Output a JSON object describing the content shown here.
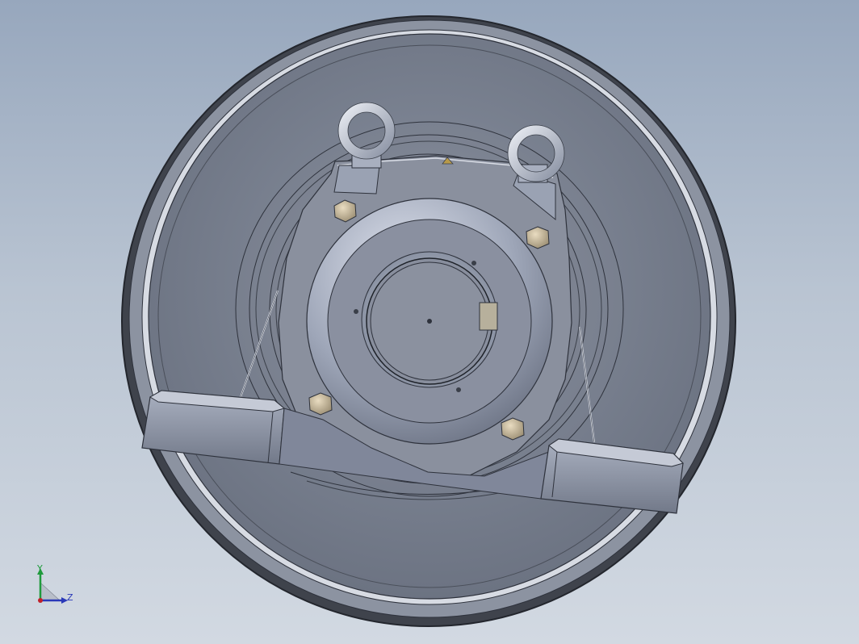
{
  "viewport": {
    "background_top": "#97a7bd",
    "background_bottom": "#d2d9e2"
  },
  "model": {
    "metal_color": "#7f8797",
    "edge_color": "#2e323c"
  },
  "triad": {
    "y_label": "Y",
    "z_label": "Z",
    "y_color": "#1f9a3c",
    "z_color": "#2a39b8",
    "origin_color": "#c0202a"
  }
}
